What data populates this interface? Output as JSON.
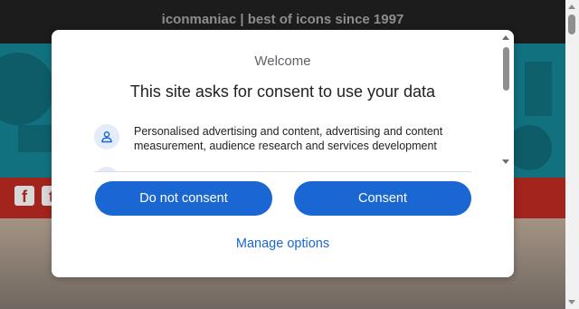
{
  "site": {
    "tagline": "iconmaniac | best of icons since 1997"
  },
  "social": {
    "icons": [
      "facebook-icon",
      "twitter-icon"
    ],
    "facebook_glyph": "f",
    "twitter_glyph": "t"
  },
  "dialog": {
    "welcome": "Welcome",
    "title": "This site asks for consent to use your data",
    "purposes": [
      {
        "icon": "person-icon",
        "text": "Personalised advertising and content, advertising and content measurement, audience research and services development"
      }
    ],
    "do_not_consent_label": "Do not consent",
    "consent_label": "Consent",
    "manage_options_label": "Manage options"
  },
  "colors": {
    "primary_button": "#1a66d2",
    "header_bg": "#1c1c1c",
    "hero_bg": "#11717f",
    "social_bar_bg": "#a3231d"
  }
}
